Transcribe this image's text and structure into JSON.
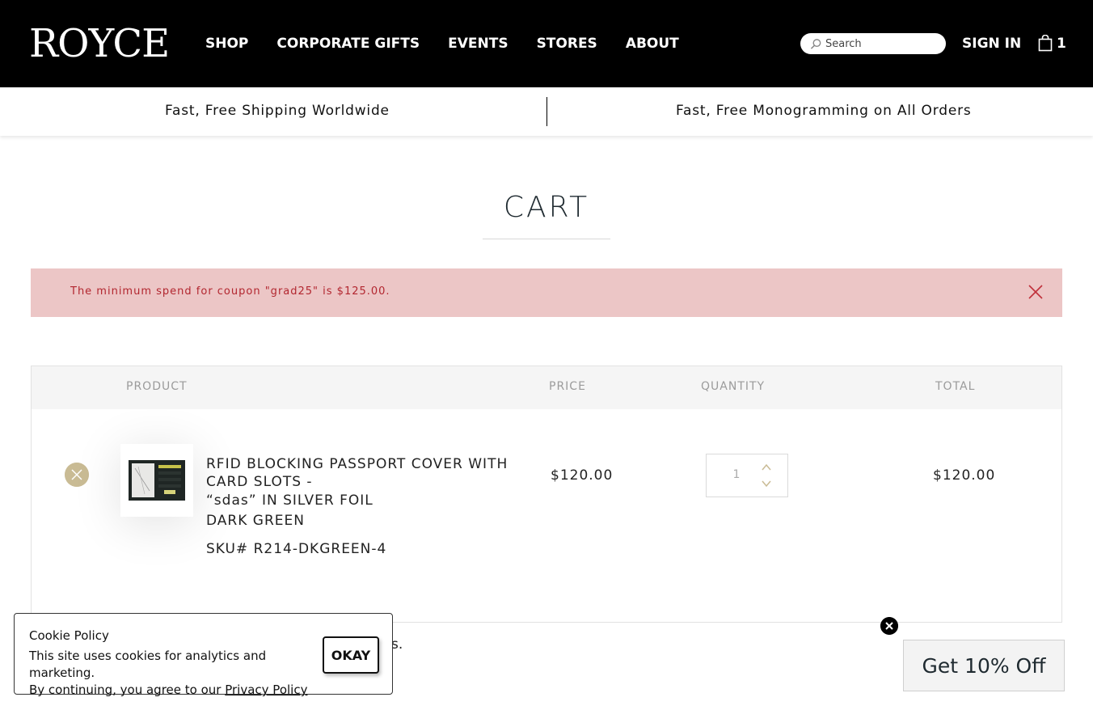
{
  "header": {
    "logo": "ROYCE",
    "nav": [
      "SHOP",
      "CORPORATE GIFTS",
      "EVENTS",
      "STORES",
      "ABOUT"
    ],
    "search_placeholder": "Search",
    "sign_in": "SIGN IN",
    "cart_count": "1"
  },
  "announcement": {
    "left": "Fast, Free Shipping Worldwide",
    "right": "Fast, Free Monogramming on All Orders"
  },
  "page_title": "CART",
  "error": {
    "message": "The minimum spend for coupon \"grad25\" is $125.00."
  },
  "table": {
    "headers": {
      "product": "PRODUCT",
      "price": "PRICE",
      "quantity": "QUANTITY",
      "total": "TOTAL"
    },
    "item": {
      "name_line1": "RFID BLOCKING PASSPORT COVER WITH",
      "name_line2": "CARD SLOTS -",
      "name_line3": "“sdas” IN SILVER FOIL",
      "name_line4": "DARK GREEN",
      "sku": "SKU# R214-DKGREEN-4",
      "price": "$120.00",
      "quantity": "1",
      "total": "$120.00"
    }
  },
  "partial_text": "s.",
  "cookie": {
    "title": "Cookie Policy",
    "line1": "This site uses cookies for analytics and marketing.",
    "line2": "By continuing, you agree to our",
    "link": "Privacy Policy",
    "button": "OKAY"
  },
  "promo": {
    "label": "Get 10% Off"
  },
  "colors": {
    "header_bg": "#000000",
    "error_bg": "#ecc6c6",
    "error_text": "#b2262f",
    "accent_gold": "#c9bb94"
  }
}
